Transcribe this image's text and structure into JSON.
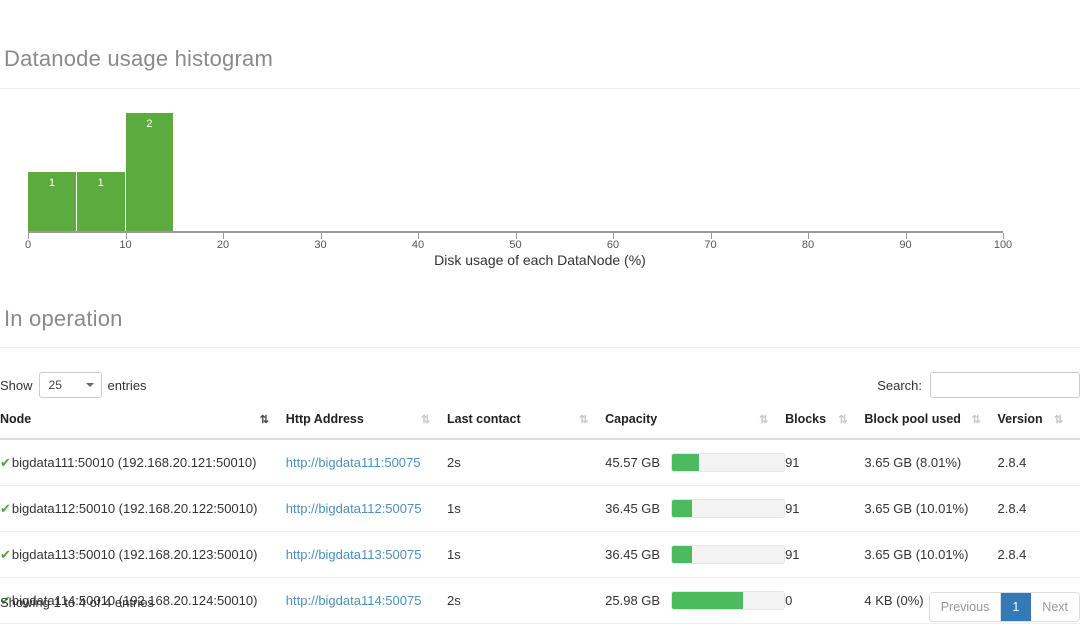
{
  "histogram": {
    "title": "Datanode usage histogram",
    "axis_caption": "Disk usage of each DataNode (%)"
  },
  "chart_data": {
    "type": "bar",
    "title": "Datanode usage histogram",
    "xlabel": "Disk usage of each DataNode (%)",
    "ylabel": "",
    "xlim": [
      0,
      100
    ],
    "ylim": [
      0,
      2
    ],
    "grid": false,
    "legend": "none",
    "bar_color": "#5cab3e",
    "bin_width": 5,
    "xticks": [
      0,
      10,
      20,
      30,
      40,
      50,
      60,
      70,
      80,
      90,
      100
    ],
    "bins": [
      {
        "x0": 0,
        "x1": 5,
        "value": 1,
        "label": "1"
      },
      {
        "x0": 5,
        "x1": 10,
        "value": 1,
        "label": "1"
      },
      {
        "x0": 10,
        "x1": 15,
        "value": 2,
        "label": "2"
      }
    ]
  },
  "section": {
    "in_operation_title": "In operation"
  },
  "controls": {
    "show_label": "Show",
    "entries_label": "entries",
    "page_length": "25",
    "search_label": "Search:",
    "search_value": "",
    "search_placeholder": ""
  },
  "table": {
    "headers": [
      "Node",
      "Http Address",
      "Last contact",
      "Capacity",
      "Blocks",
      "Block pool used",
      "Version"
    ],
    "rows": [
      {
        "status_icon": "check-icon",
        "node": "bigdata111:50010 (192.168.20.121:50010)",
        "http_address": "http://bigdata111:50075",
        "last_contact": "2s",
        "capacity": "45.57 GB",
        "capacity_percent": 24,
        "blocks": "91",
        "block_pool_used": "3.65 GB (8.01%)",
        "version": "2.8.4"
      },
      {
        "status_icon": "check-icon",
        "node": "bigdata112:50010 (192.168.20.122:50010)",
        "http_address": "http://bigdata112:50075",
        "last_contact": "1s",
        "capacity": "36.45 GB",
        "capacity_percent": 18,
        "blocks": "91",
        "block_pool_used": "3.65 GB (10.01%)",
        "version": "2.8.4"
      },
      {
        "status_icon": "check-icon",
        "node": "bigdata113:50010 (192.168.20.123:50010)",
        "http_address": "http://bigdata113:50075",
        "last_contact": "1s",
        "capacity": "36.45 GB",
        "capacity_percent": 18,
        "blocks": "91",
        "block_pool_used": "3.65 GB (10.01%)",
        "version": "2.8.4"
      },
      {
        "status_icon": "check-icon",
        "node": "bigdata114:50010 (192.168.20.124:50010)",
        "http_address": "http://bigdata114:50075",
        "last_contact": "2s",
        "capacity": "25.98 GB",
        "capacity_percent": 63,
        "blocks": "0",
        "block_pool_used": "4 KB (0%)",
        "version": "2.8.4"
      }
    ]
  },
  "footer": {
    "info": "Showing 1 to 4 of 4 entries",
    "previous_label": "Previous",
    "page_1_label": "1",
    "next_label": "Next"
  },
  "colors": {
    "histogram_green": "#5cab3e",
    "bar_green": "#4cbb5e",
    "link_blue": "#4a90c4",
    "accent_blue": "#337ab7",
    "check_green": "#4ca832"
  }
}
